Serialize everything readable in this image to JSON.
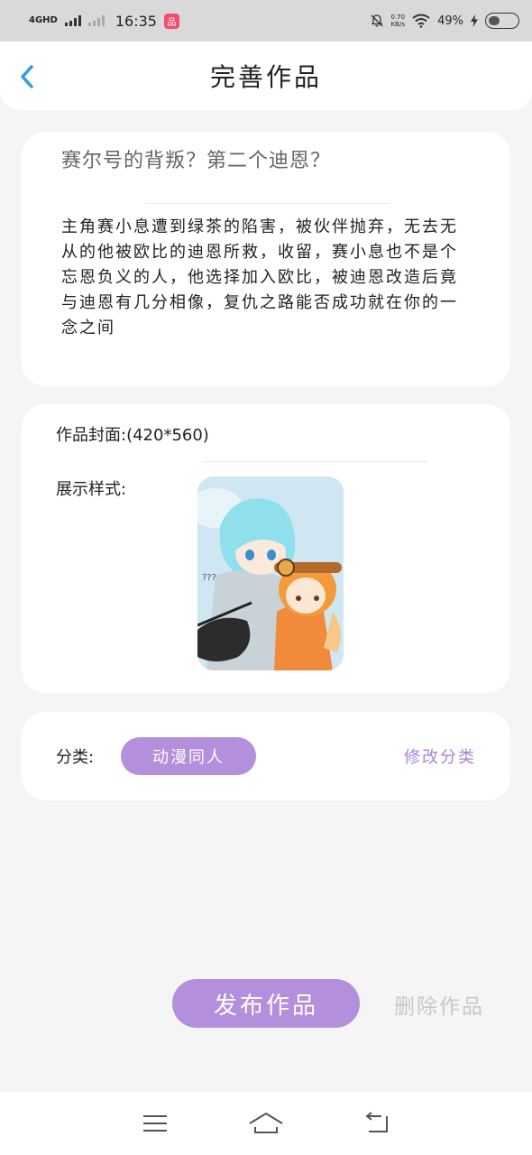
{
  "status_bar": {
    "network": "4GHD",
    "time": "16:35",
    "net_speed_value": "0.70",
    "net_speed_unit": "KB/s",
    "battery_percent": "49%",
    "battery_level": 0.49
  },
  "header": {
    "title": "完善作品"
  },
  "work": {
    "title": "赛尔号的背叛？第二个迪恩？",
    "summary": "主角赛小息遭到绿茶的陷害，被伙伴抛弃，无去无从的他被欧比的迪恩所救，收留，赛小息也不是个忘恩负义的人，他选择加入欧比，被迪恩改造后竟与迪恩有几分相像，复仇之路能否成功就在你的一念之间"
  },
  "cover": {
    "label": "作品封面:(420*560)",
    "display_label": "展示样式:"
  },
  "category": {
    "label": "分类:",
    "tag": "动漫同人",
    "edit_label": "修改分类"
  },
  "actions": {
    "publish_label": "发布作品",
    "delete_label": "删除作品"
  },
  "colors": {
    "accent": "#b48fdc",
    "back_arrow": "#2f9de8",
    "background": "#f5f5f5"
  }
}
